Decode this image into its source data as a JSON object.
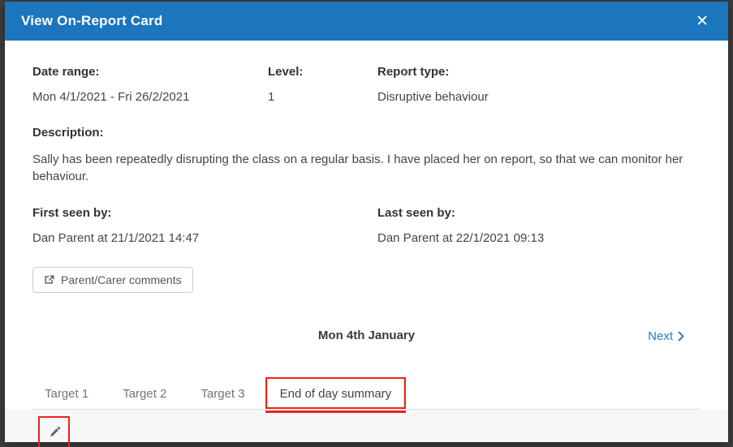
{
  "modal": {
    "title": "View On-Report Card"
  },
  "icons": {
    "close": "✕"
  },
  "fields": {
    "date_range": {
      "label": "Date range:",
      "value": "Mon 4/1/2021 - Fri 26/2/2021"
    },
    "level": {
      "label": "Level:",
      "value": "1"
    },
    "report_type": {
      "label": "Report type:",
      "value": "Disruptive behaviour"
    },
    "description": {
      "label": "Description:",
      "value": "Sally has been repeatedly disrupting the class on a regular basis. I have placed her on report, so that we can monitor her behaviour."
    },
    "first_seen": {
      "label": "First seen by:",
      "value": "Dan Parent at 21/1/2021 14:47"
    },
    "last_seen": {
      "label": "Last seen by:",
      "value": "Dan Parent at 22/1/2021 09:13"
    }
  },
  "buttons": {
    "parent_carer_comments": "Parent/Carer comments"
  },
  "day_nav": {
    "current_day": "Mon 4th January",
    "next": "Next"
  },
  "tabs": [
    {
      "label": "Target 1",
      "active": false
    },
    {
      "label": "Target 2",
      "active": false
    },
    {
      "label": "Target 3",
      "active": false
    },
    {
      "label": "End of day summary",
      "active": true
    }
  ],
  "annotations": {
    "highlight_color": "#e8251f",
    "highlighted": [
      "tab-end-of-day-summary",
      "edit-pencil-button"
    ]
  },
  "colors": {
    "header_bg": "#1b76be",
    "link_blue": "#2a7cc0",
    "annotation_red": "#e8251f",
    "backdrop": "#3d3d3d"
  }
}
